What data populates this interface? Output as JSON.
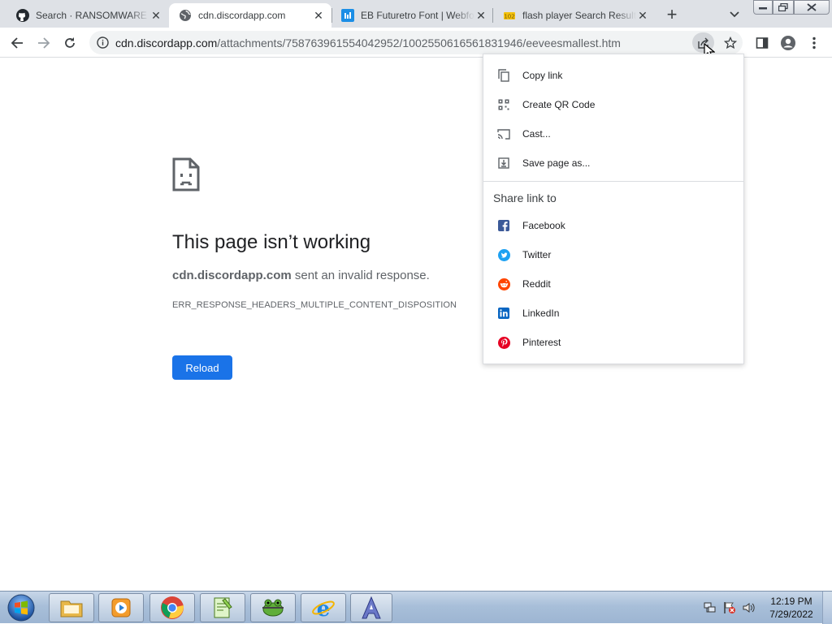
{
  "tabs": [
    {
      "title": "Search · RANSOMWARE E",
      "icon": "github-icon",
      "active": false
    },
    {
      "title": "cdn.discordapp.com",
      "icon": "globe-icon",
      "active": true
    },
    {
      "title": "EB Futuretro Font | Webfo",
      "icon": "font-site-icon",
      "active": false
    },
    {
      "title": "flash player Search Result",
      "icon": "search-site-icon",
      "active": false
    }
  ],
  "omnibox": {
    "host": "cdn.discordapp.com",
    "path": "/attachments/758763961554042952/1002550616561831946/eeveesmallest.htm"
  },
  "error_page": {
    "title": "This page isn’t working",
    "host": "cdn.discordapp.com",
    "desc_suffix": " sent an invalid response.",
    "code": "ERR_RESPONSE_HEADERS_MULTIPLE_CONTENT_DISPOSITION",
    "reload_label": "Reload"
  },
  "share_menu": {
    "items": [
      {
        "label": "Copy link",
        "icon": "copy-link-icon"
      },
      {
        "label": "Create QR Code",
        "icon": "qr-code-icon"
      },
      {
        "label": "Cast...",
        "icon": "cast-icon"
      },
      {
        "label": "Save page as...",
        "icon": "save-page-icon"
      }
    ],
    "share_heading": "Share link to",
    "targets": [
      {
        "label": "Facebook",
        "icon": "facebook-icon",
        "color": "#3b5998"
      },
      {
        "label": "Twitter",
        "icon": "twitter-icon",
        "color": "#1da1f2"
      },
      {
        "label": "Reddit",
        "icon": "reddit-icon",
        "color": "#ff4500"
      },
      {
        "label": "LinkedIn",
        "icon": "linkedin-icon",
        "color": "#0a66c2"
      },
      {
        "label": "Pinterest",
        "icon": "pinterest-icon",
        "color": "#e60023"
      }
    ]
  },
  "taskbar": {
    "apps": [
      "file-explorer-icon",
      "media-player-icon",
      "chrome-icon",
      "notepad-plus-plus-icon",
      "frog-app-icon",
      "internet-explorer-icon",
      "app-a-icon"
    ],
    "clock_time": "12:19 PM",
    "clock_date": "7/29/2022"
  },
  "colors": {
    "accent": "#1a73e8",
    "tabstrip": "#dee1e6",
    "omnibox": "#f1f3f4"
  }
}
